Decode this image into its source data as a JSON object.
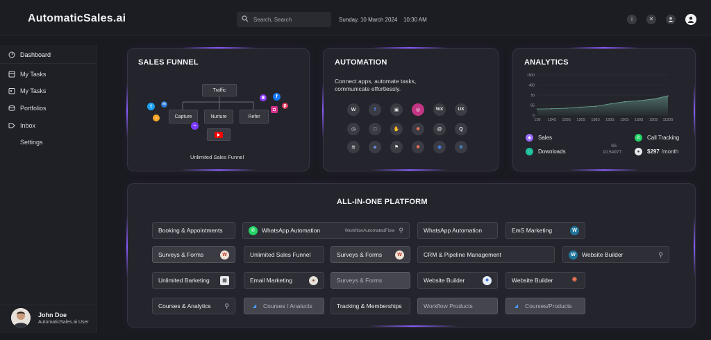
{
  "app": {
    "brand": "AutomaticSales.ai"
  },
  "header": {
    "search_placeholder": "Search, Search",
    "date": "Sunday, 10 March 2024",
    "time": "10:30 AM",
    "icons": [
      "info-icon",
      "close-icon",
      "user-icon",
      "profile-avatar-icon"
    ]
  },
  "sidebar": {
    "items": [
      {
        "label": "Dashboard",
        "icon": "dashboard-icon"
      },
      {
        "label": "My Tasks",
        "icon": "tasks-icon"
      },
      {
        "label": "My Tasks",
        "icon": "calendar-icon"
      },
      {
        "label": "Portfolios",
        "icon": "portfolio-icon"
      },
      {
        "label": "Inbox",
        "icon": "inbox-icon"
      },
      {
        "label": "Settings",
        "icon": ""
      }
    ],
    "user": {
      "name": "John Doe",
      "role": "AutomaticSales.ai User"
    }
  },
  "funnel": {
    "title": "SALES FUNNEL",
    "nodes": {
      "top": "Traffic",
      "left": "Capture",
      "mid": "Nurture",
      "right": "Refer"
    },
    "caption": "Unlimited Sales Funnel"
  },
  "automation": {
    "title": "AUTOMATION",
    "desc_lines": [
      "Connect apps, automate tasks,",
      "communicate effortlessly."
    ],
    "apps": [
      [
        "wordpress",
        "facebook",
        "square-app",
        "instagram",
        "wix",
        "ux"
      ],
      [
        "clock",
        "square-outline",
        "hand",
        "hubspot",
        "at-sign",
        "quora"
      ],
      [
        "layers",
        "stack",
        "flag",
        "hubspot",
        "chrome",
        "globe"
      ]
    ],
    "app_labels": {
      "wix": "WX",
      "ux": "UX"
    }
  },
  "analytics": {
    "title": "ANALYTICS",
    "legend": [
      {
        "label": "Sales",
        "color": "#9a6cff"
      },
      {
        "label": "Downloads",
        "color": "#1dbf9b"
      },
      {
        "label": "Call Tracking",
        "color": "#25d366"
      },
      {
        "label": "$297 /month",
        "color": "#e8e8ec"
      }
    ],
    "stat_small_1": "S5",
    "stat_small_2": "10.54977",
    "price": "$297",
    "price_unit": "/month"
  },
  "chart_data": {
    "type": "area",
    "x": [
      "1S0",
      "1S4S",
      "1S0S",
      "1S0S",
      "1S0S",
      "1S0S",
      "1S0S",
      "1S0S",
      "1S0S",
      "11S0S"
    ],
    "values": [
      230,
      240,
      260,
      300,
      330,
      420,
      500,
      540,
      600,
      720
    ],
    "yticks": [
      "1500",
      "400",
      "50",
      "S5",
      "0"
    ],
    "ylim": [
      0,
      1500
    ],
    "color": "#6ea79b"
  },
  "platform": {
    "title": "ALL-IN-ONE PLATFORM",
    "pills": [
      {
        "label": "Booking & Appointments"
      },
      {
        "label": "WhatsApp Automation",
        "sub": "WorkflowAutomatedFlow"
      },
      {
        "label": "WhatsApp Automation"
      },
      {
        "label": "EmS Marketing"
      },
      {
        "label": "Surveys & Forms"
      },
      {
        "label": "Unlimited Sales Funnel"
      },
      {
        "label": "Surveys & Forms"
      },
      {
        "label": "CRM & Pipeline Management"
      },
      {
        "label": "Website Builder"
      },
      {
        "label": "Unlimited Barketing"
      },
      {
        "label": "Email Marketing"
      },
      {
        "label": "Surveys & Forms"
      },
      {
        "label": "Website Builder"
      },
      {
        "label": "Website Builder"
      },
      {
        "label": "Courses & Analytics"
      },
      {
        "label": "Courses / Analucts"
      },
      {
        "label": "Tracking & Memberships"
      },
      {
        "label": "Workflow Products"
      },
      {
        "label": "Courses/Products"
      }
    ]
  }
}
